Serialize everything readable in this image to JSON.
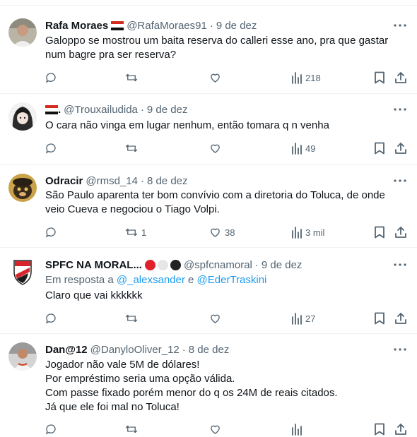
{
  "tweets": [
    {
      "name": "Rafa Moraes",
      "handle": "@RafaMoraes91",
      "date": "9 de dez",
      "lines": [
        "Galoppo se mostrou um baita reserva do calleri esse ano, pra que gastar",
        "num bagre pra ser reserva?"
      ],
      "replies": "",
      "retweets": "",
      "likes": "",
      "views": "218"
    },
    {
      "name": ".",
      "handle": "@Trouxailudida",
      "date": "9 de dez",
      "lines": [
        "O cara não vinga em lugar nenhum, então tomara q n venha"
      ],
      "replies": "",
      "retweets": "",
      "likes": "",
      "views": "49"
    },
    {
      "name": "Odracir",
      "handle": "@rmsd_14",
      "date": "8 de dez",
      "lines": [
        "São Paulo aparenta ter bom convívio com a diretoria do Toluca, de onde",
        "veio Cueva e negociou o Tiago Volpi."
      ],
      "replies": "",
      "retweets": "1",
      "likes": "38",
      "views": "3 mil"
    },
    {
      "name": "SPFC NA MORAL...",
      "handle": "@spfcnamoral",
      "date": "9 de dez",
      "reply_prefix": "Em resposta a",
      "reply_user1": "@_alexsander",
      "reply_and": "e",
      "reply_user2": "@EderTraskini",
      "lines": [
        "Claro que vai kkkkkk"
      ],
      "replies": "",
      "retweets": "",
      "likes": "",
      "views": "27"
    },
    {
      "name": "Dan@12",
      "handle": "@DanyloOliver_12",
      "date": "8 de dez",
      "lines": [
        "Jogador não vale 5M de dólares!",
        "Por empréstimo seria uma opção válida.",
        "Com passe fixado porém menor do q os 24M de reais citados.",
        "Já que ele foi mal no Toluca!"
      ]
    }
  ],
  "colors": {
    "text": "#0f1419",
    "secondary": "#536471",
    "link": "#1d9bf0",
    "divider": "#eff3f4",
    "badge_red": "#e0202b",
    "badge_white": "#e6e6e6",
    "badge_black": "#222222"
  },
  "icons": [
    "more-icon",
    "reply-icon",
    "retweet-icon",
    "like-icon",
    "views-icon",
    "bookmark-icon",
    "share-icon",
    "flag-icon"
  ]
}
